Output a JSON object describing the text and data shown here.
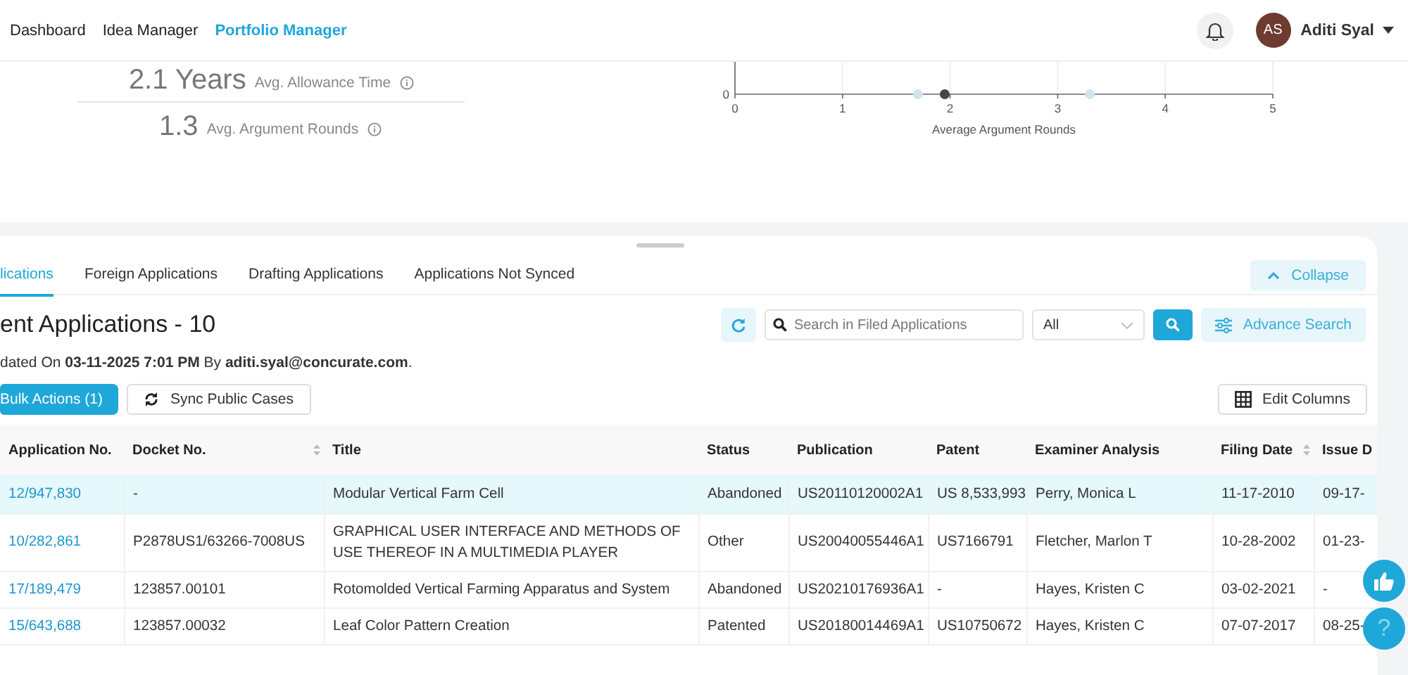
{
  "header": {
    "nav": [
      {
        "label": "Dashboard",
        "selected": false
      },
      {
        "label": "Idea Manager",
        "selected": false
      },
      {
        "label": "Portfolio Manager",
        "selected": true
      }
    ],
    "user": {
      "initials": "AS",
      "name": "Aditi Syal"
    }
  },
  "stats": [
    {
      "value": "2.1 Years",
      "label": "Avg. Allowance Time"
    },
    {
      "value": "1.3",
      "label": "Avg. Argument Rounds"
    }
  ],
  "chart": {
    "kind": "picture",
    "xlabel": "Average Argument Rounds",
    "x_tick_labels": [
      "0",
      "1",
      "2",
      "3",
      "4",
      "5"
    ],
    "y_tick_label": "0"
  },
  "tabs": [
    {
      "label": "lications",
      "selected": true
    },
    {
      "label": "Foreign Applications",
      "selected": false
    },
    {
      "label": "Drafting Applications",
      "selected": false
    },
    {
      "label": "Applications Not Synced",
      "selected": false
    }
  ],
  "collapse_button": "Collapse",
  "title": "ent Applications - 10",
  "updated": "dated On **03-11-2025 7:01 PM** By **aditi.syal@concurate.com**.",
  "search": {
    "placeholder": "Search in Filed Applications"
  },
  "filter": {
    "value": "All"
  },
  "advance_search": "Advance Search",
  "bulk_actions": "Bulk Actions (1)",
  "sync_button": "Sync Public Cases",
  "edit_columns": "Edit Columns",
  "table": {
    "columns": [
      {
        "label": "Application No.",
        "sortable": false
      },
      {
        "label": "Docket No.",
        "sortable": true
      },
      {
        "label": "Title",
        "sortable": false
      },
      {
        "label": "Status",
        "sortable": false
      },
      {
        "label": "Publication",
        "sortable": false
      },
      {
        "label": "Patent",
        "sortable": false
      },
      {
        "label": "Examiner Analysis",
        "sortable": false
      },
      {
        "label": "Filing Date",
        "sortable": true
      },
      {
        "label": "Issue D",
        "sortable": false
      }
    ],
    "rows": [
      {
        "selected": true,
        "cells": [
          "12/947,830",
          "-",
          "Modular Vertical Farm Cell",
          "Abandoned",
          "US20110120002A1",
          "US 8,533,993",
          "Perry, Monica L",
          "11-17-2010",
          "09-17-"
        ]
      },
      {
        "selected": false,
        "cells": [
          "10/282,861",
          "P2878US1/63266-7008US",
          "GRAPHICAL USER INTERFACE AND METHODS OF USE THEREOF IN A MULTIMEDIA PLAYER",
          "Other",
          "US20040055446A1",
          "US7166791",
          "Fletcher, Marlon T",
          "10-28-2002",
          "01-23-"
        ]
      },
      {
        "selected": false,
        "cells": [
          "17/189,479",
          "123857.00101",
          "Rotomolded Vertical Farming Apparatus and System",
          "Abandoned",
          "US20210176936A1",
          "-",
          "Hayes, Kristen C",
          "03-02-2021",
          "-"
        ]
      },
      {
        "selected": false,
        "cells": [
          "15/643,688",
          "123857.00032",
          "Leaf Color Pattern Creation",
          "Patented",
          "US20180014469A1",
          "US10750672",
          "Hayes, Kristen C",
          "07-07-2017",
          "08-25-"
        ]
      }
    ]
  },
  "help_button": "?"
}
